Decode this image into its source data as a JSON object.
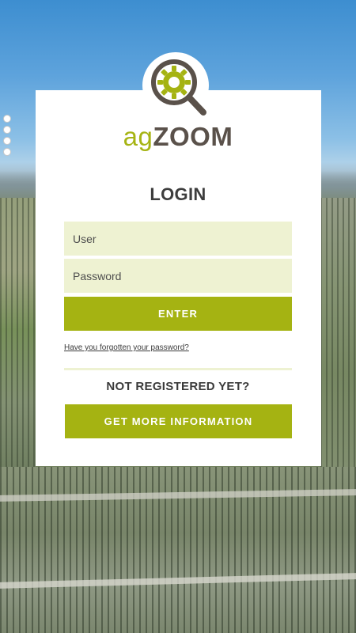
{
  "brand": {
    "part1": "ag",
    "part2": "ZOOM",
    "accent_color": "#a5b312",
    "dark_color": "#5a514a",
    "logo_icon": "magnifier-gear-icon"
  },
  "pager": {
    "dot_count": 4
  },
  "login": {
    "title": "LOGIN",
    "user_placeholder": "User",
    "password_placeholder": "Password",
    "enter_label": "ENTER",
    "forgot_link": "Have you forgotten your password?"
  },
  "register": {
    "heading": "NOT REGISTERED YET?",
    "info_button_label": "GET MORE INFORMATION"
  }
}
